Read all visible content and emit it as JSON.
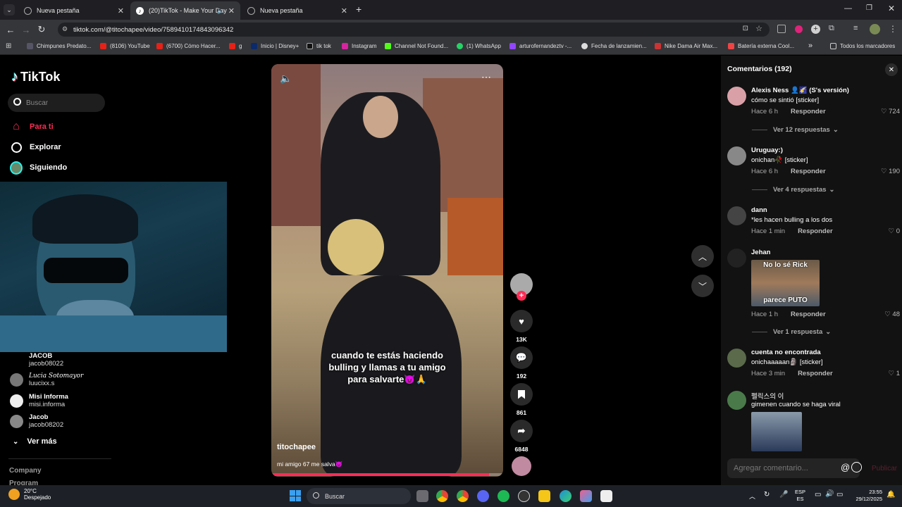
{
  "tabs": [
    {
      "title": "Nueva pestaña",
      "active": false
    },
    {
      "title": "(20)TikTok - Make Your Day",
      "active": true
    },
    {
      "title": "Nueva pestaña",
      "active": false
    }
  ],
  "address": {
    "url": "tiktok.com/@titochapee/video/7589410174843096342"
  },
  "bookmarks": [
    {
      "label": "Chimpunes Predato..."
    },
    {
      "label": "(8106) YouTube"
    },
    {
      "label": "(6700) Cómo Hacer..."
    },
    {
      "label": "g"
    },
    {
      "label": "Inicio | Disney+"
    },
    {
      "label": "tik tok"
    },
    {
      "label": "Instagram"
    },
    {
      "label": "Channel Not Found..."
    },
    {
      "label": "(1) WhatsApp"
    },
    {
      "label": "arturofernandeztv -..."
    },
    {
      "label": "Fecha de lanzamien..."
    },
    {
      "label": "Nike Dama Air Max..."
    },
    {
      "label": "Batería externa Cool..."
    },
    {
      "label": "»"
    },
    {
      "label": "Todos los marcadores"
    }
  ],
  "sidebar": {
    "logo": "TikTok",
    "search_placeholder": "Buscar",
    "nav": [
      {
        "label": "Para ti"
      },
      {
        "label": "Explorar"
      },
      {
        "label": "Siguiendo"
      }
    ],
    "following": [
      {
        "name": "JACOB",
        "handle": "jacob08022"
      },
      {
        "name": "Lucia Sotomayor",
        "handle": "luucixx.s"
      },
      {
        "name": "Misi Informa",
        "handle": "misi.informa"
      },
      {
        "name": "Jacob",
        "handle": "jacob08202"
      }
    ],
    "see_more": "Ver más",
    "footer": [
      "Company",
      "Program"
    ]
  },
  "video": {
    "caption_lines": [
      "cuando te estás haciendo",
      "bulling y llamas a tu amigo",
      "para salvarte😈🙏"
    ],
    "author": "titochapee",
    "description": "mi amigo 67 me salva😈",
    "progress": 0.94
  },
  "actions": {
    "likes": "13K",
    "comments": "192",
    "saves": "861",
    "shares": "6848"
  },
  "comments_panel": {
    "title": "Comentarios (192)",
    "reply_label": "Responder",
    "items": [
      {
        "user": "Alexis Ness 👤🌠 (S's versión)",
        "text": "cómo se sintió [sticker]",
        "time": "Hace 6 h",
        "likes": "724",
        "replies": "Ver 12 respuestas"
      },
      {
        "user": "Uruguay:)",
        "text": "onichan🥀 [sticker]",
        "time": "Hace 6 h",
        "likes": "190",
        "replies": "Ver 4 respuestas"
      },
      {
        "user": "dann",
        "text": "*les hacen bulling a los dos",
        "time": "Hace 1 min",
        "likes": "0",
        "replies": ""
      },
      {
        "user": "Jehan",
        "text": "",
        "image_top": "No lo sé Rick",
        "image_bottom": "parece PUTO",
        "time": "Hace 1 h",
        "likes": "48",
        "replies": "Ver 1 respuesta"
      },
      {
        "user": "cuenta no encontrada",
        "text": "onichaaaaan🗿 [sticker]",
        "time": "Hace 3 min",
        "likes": "1",
        "replies": ""
      },
      {
        "user": "펠릭스의 이",
        "text": "gimenen cuando se haga viral",
        "time": "",
        "likes": "",
        "replies": ""
      }
    ],
    "input_placeholder": "Agregar comentario...",
    "post_label": "Publicar"
  },
  "taskbar": {
    "weather_temp": "20°C",
    "weather_desc": "Despejado",
    "search_label": "Buscar",
    "lang_top": "ESP",
    "lang_bottom": "ES",
    "time": "23:55",
    "date": "29/12/2025"
  }
}
